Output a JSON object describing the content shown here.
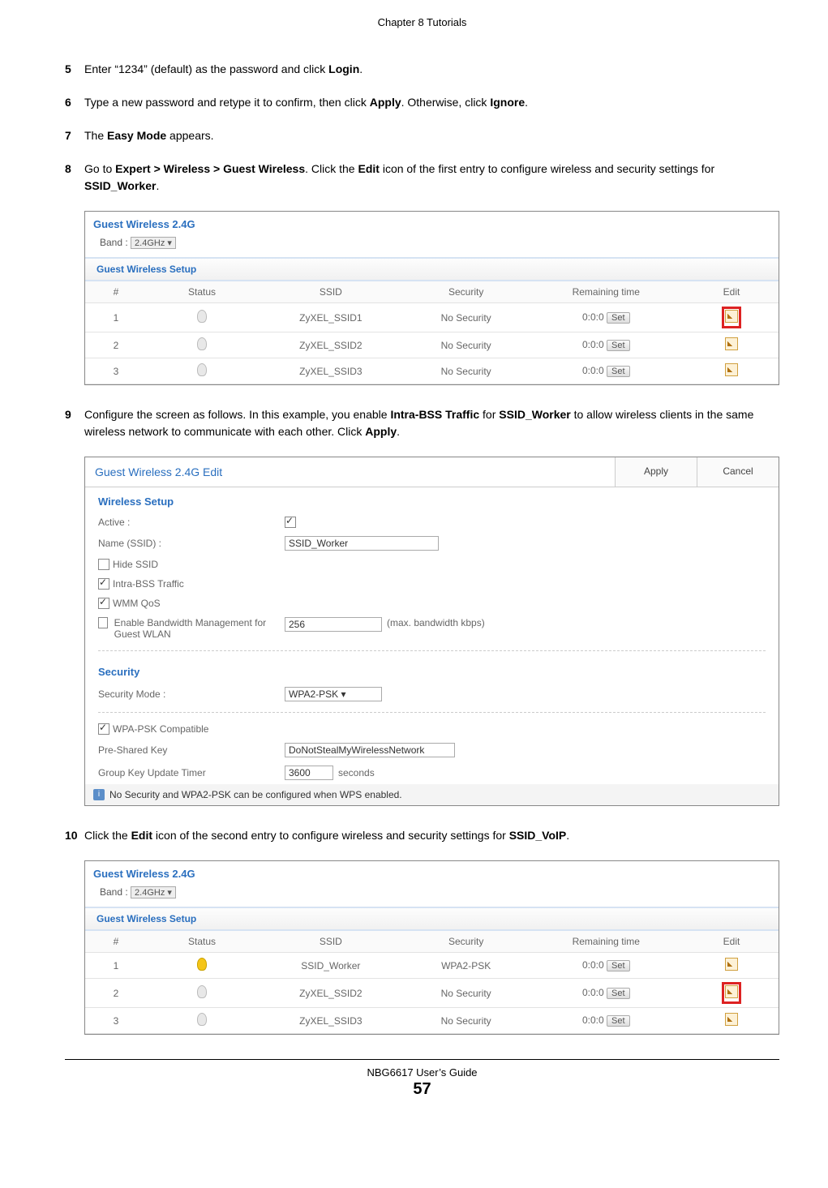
{
  "chapter": "Chapter 8 Tutorials",
  "steps": {
    "5": {
      "num": "5",
      "pre": "Enter “1234” (default) as the password and click ",
      "b1": "Login",
      "post": "."
    },
    "6": {
      "num": "6",
      "pre": "Type a new password and retype it to confirm, then click ",
      "b1": "Apply",
      "mid": ". Otherwise, click ",
      "b2": "Ignore",
      "post": "."
    },
    "7": {
      "num": "7",
      "pre": "The ",
      "b1": "Easy Mode",
      "post": " appears."
    },
    "8": {
      "num": "8",
      "pre": "Go to ",
      "b1": "Expert > Wireless > Guest Wireless",
      "mid": ". Click the ",
      "b2": "Edit",
      "mid2": " icon of the first entry to configure wireless and security settings for ",
      "b3": "SSID_Worker",
      "post": "."
    },
    "9": {
      "num": "9",
      "pre": "Configure the screen as follows. In this example, you enable ",
      "b1": "Intra-BSS Traffic",
      "mid": " for ",
      "b2": "SSID_Worker",
      "mid2": " to allow wireless clients in the same wireless network to communicate with each other. Click ",
      "b3": "Apply",
      "post": "."
    },
    "10": {
      "num": "10",
      "pre": "Click the ",
      "b1": "Edit",
      "mid": " icon of the second entry to configure wireless and security settings for ",
      "b2": "SSID_VoIP",
      "post": "."
    }
  },
  "gw1": {
    "title": "Guest Wireless 2.4G",
    "band_label": "Band :",
    "band_value": "2.4GHz ▾",
    "subhead": "Guest Wireless  Setup",
    "cols": {
      "num": "#",
      "status": "Status",
      "ssid": "SSID",
      "security": "Security",
      "remaining": "Remaining time",
      "edit": "Edit"
    },
    "rows": [
      {
        "n": "1",
        "ssid": "ZyXEL_SSID1",
        "sec": "No Security",
        "rt": "0:0:0",
        "set": "Set",
        "hl": true
      },
      {
        "n": "2",
        "ssid": "ZyXEL_SSID2",
        "sec": "No Security",
        "rt": "0:0:0",
        "set": "Set",
        "hl": false
      },
      {
        "n": "3",
        "ssid": "ZyXEL_SSID3",
        "sec": "No Security",
        "rt": "0:0:0",
        "set": "Set",
        "hl": false
      }
    ]
  },
  "edit": {
    "title": "Guest Wireless 2.4G Edit",
    "apply": "Apply",
    "cancel": "Cancel",
    "wireless_setup": "Wireless Setup",
    "active": "Active :",
    "name_label": "Name (SSID) :",
    "name_value": "SSID_Worker",
    "hide_ssid": "Hide SSID",
    "intra_bss": "Intra-BSS Traffic",
    "wmm": "WMM QoS",
    "bw_label": "Enable Bandwidth Management for Guest WLAN",
    "bw_value": "256",
    "bw_hint": "(max. bandwidth kbps)",
    "security_head": "Security",
    "secmode_label": "Security Mode :",
    "secmode_value": "WPA2-PSK   ▾",
    "wpa_compat": "WPA-PSK Compatible",
    "psk_label": "Pre-Shared Key",
    "psk_value": "DoNotStealMyWirelessNetwork",
    "gku_label": "Group Key Update Timer",
    "gku_value": "3600",
    "gku_unit": "seconds",
    "note": "No Security and WPA2-PSK can be configured when WPS enabled."
  },
  "gw2": {
    "title": "Guest Wireless 2.4G",
    "band_label": "Band :",
    "band_value": "2.4GHz ▾",
    "subhead": "Guest Wireless  Setup",
    "cols": {
      "num": "#",
      "status": "Status",
      "ssid": "SSID",
      "security": "Security",
      "remaining": "Remaining time",
      "edit": "Edit"
    },
    "rows": [
      {
        "n": "1",
        "on": true,
        "ssid": "SSID_Worker",
        "sec": "WPA2-PSK",
        "rt": "0:0:0",
        "set": "Set",
        "hl": false
      },
      {
        "n": "2",
        "on": false,
        "ssid": "ZyXEL_SSID2",
        "sec": "No Security",
        "rt": "0:0:0",
        "set": "Set",
        "hl": true
      },
      {
        "n": "3",
        "on": false,
        "ssid": "ZyXEL_SSID3",
        "sec": "No Security",
        "rt": "0:0:0",
        "set": "Set",
        "hl": false
      }
    ]
  },
  "footer": {
    "guide": "NBG6617 User’s Guide",
    "page": "57"
  }
}
